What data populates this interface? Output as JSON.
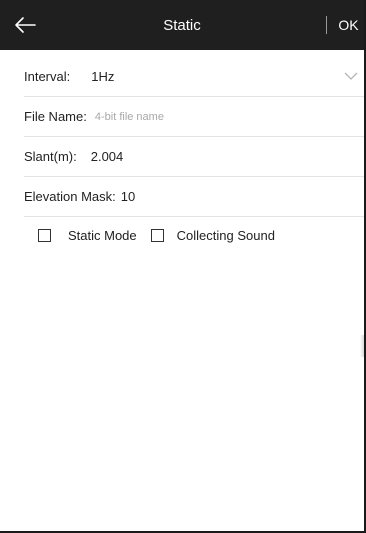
{
  "header": {
    "title": "Static",
    "ok_label": "OK",
    "back_icon": "arrow-left-icon",
    "background": "#1f1f1f"
  },
  "form": {
    "interval": {
      "label": "Interval:",
      "value": "1Hz",
      "icon": "chevron-down-icon"
    },
    "file_name": {
      "label": "File Name:",
      "value": "",
      "placeholder": "4-bit file name"
    },
    "slant": {
      "label": "Slant(m):",
      "value": "2.004"
    },
    "elevation_mask": {
      "label": "Elevation Mask:",
      "value": "10"
    },
    "static_mode": {
      "label": "Static Mode",
      "checked": false
    },
    "collecting_sound": {
      "label": "Collecting Sound",
      "checked": false
    }
  }
}
